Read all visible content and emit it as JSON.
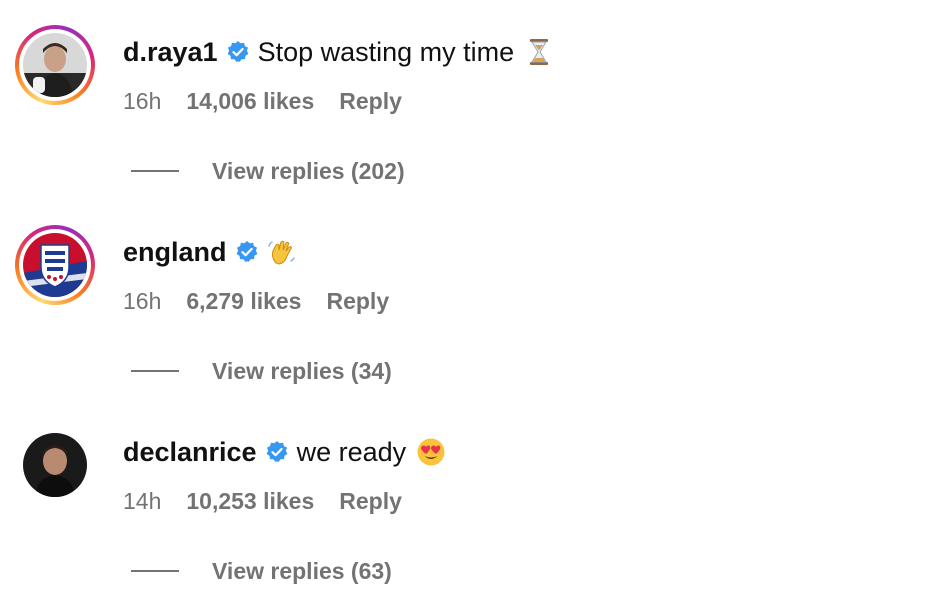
{
  "comments": [
    {
      "username": "d.raya1",
      "text": "Stop wasting my time",
      "emoji": "hourglass-emoji",
      "time": "16h",
      "likes": "14,006 likes",
      "reply_label": "Reply",
      "view_replies": "View replies (202)",
      "has_story_ring": true
    },
    {
      "username": "england",
      "text": "",
      "emoji": "waving-hand-emoji",
      "time": "16h",
      "likes": "6,279 likes",
      "reply_label": "Reply",
      "view_replies": "View replies (34)",
      "has_story_ring": true
    },
    {
      "username": "declanrice",
      "text": "we ready",
      "emoji": "heart-eyes-emoji",
      "time": "14h",
      "likes": "10,253 likes",
      "reply_label": "Reply",
      "view_replies": "View replies (63)",
      "has_story_ring": false
    }
  ],
  "colors": {
    "verified_badge": "#3897f0",
    "secondary_text": "#737373",
    "primary_text": "#111111"
  }
}
